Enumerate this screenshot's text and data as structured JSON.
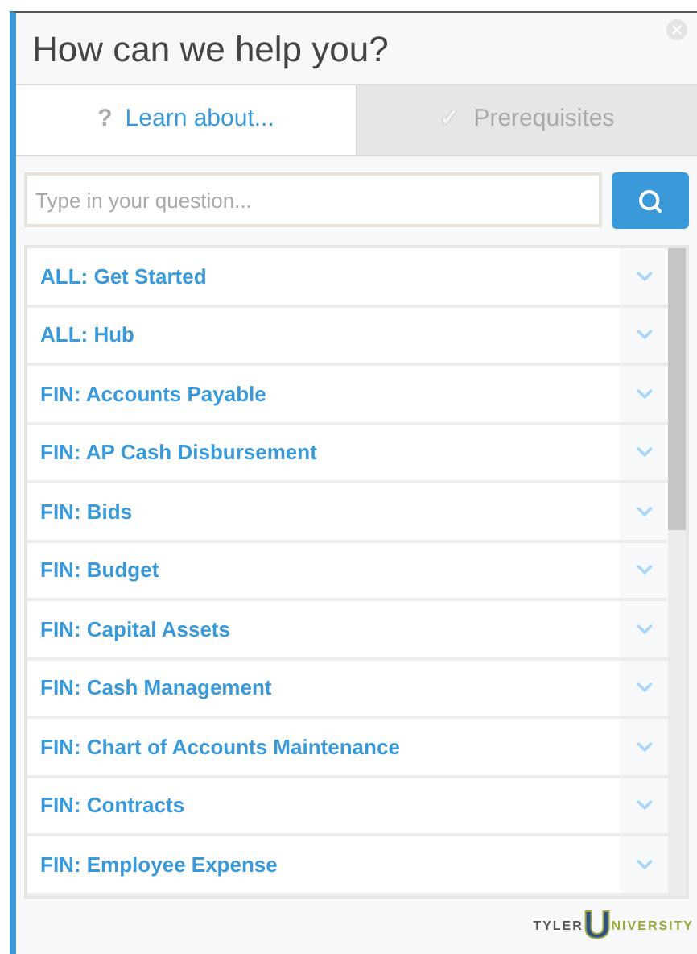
{
  "title": "How can we help you?",
  "tabs": [
    {
      "icon": "?",
      "label": "Learn about...",
      "selected": true
    },
    {
      "icon": "✓",
      "label": "Prerequisites",
      "selected": false
    }
  ],
  "search": {
    "placeholder": "Type in your question..."
  },
  "topics": [
    {
      "label": "ALL: Get Started",
      "expanded": false
    },
    {
      "label": "ALL: Hub",
      "expanded": false
    },
    {
      "label": "FIN: Accounts Payable",
      "expanded": false
    },
    {
      "label": "FIN: AP Cash Disbursement",
      "expanded": false
    },
    {
      "label": "FIN: Bids",
      "expanded": false
    },
    {
      "label": "FIN: Budget",
      "expanded": false
    },
    {
      "label": "FIN: Capital Assets",
      "expanded": false
    },
    {
      "label": "FIN: Cash Management",
      "expanded": false
    },
    {
      "label": "FIN: Chart of Accounts Maintenance",
      "expanded": false
    },
    {
      "label": "FIN: Contracts",
      "expanded": false
    },
    {
      "label": "FIN: Employee Expense",
      "expanded": false
    }
  ],
  "logo": {
    "left": "TYLER",
    "letter": "U",
    "right": "NIVERSITY"
  }
}
